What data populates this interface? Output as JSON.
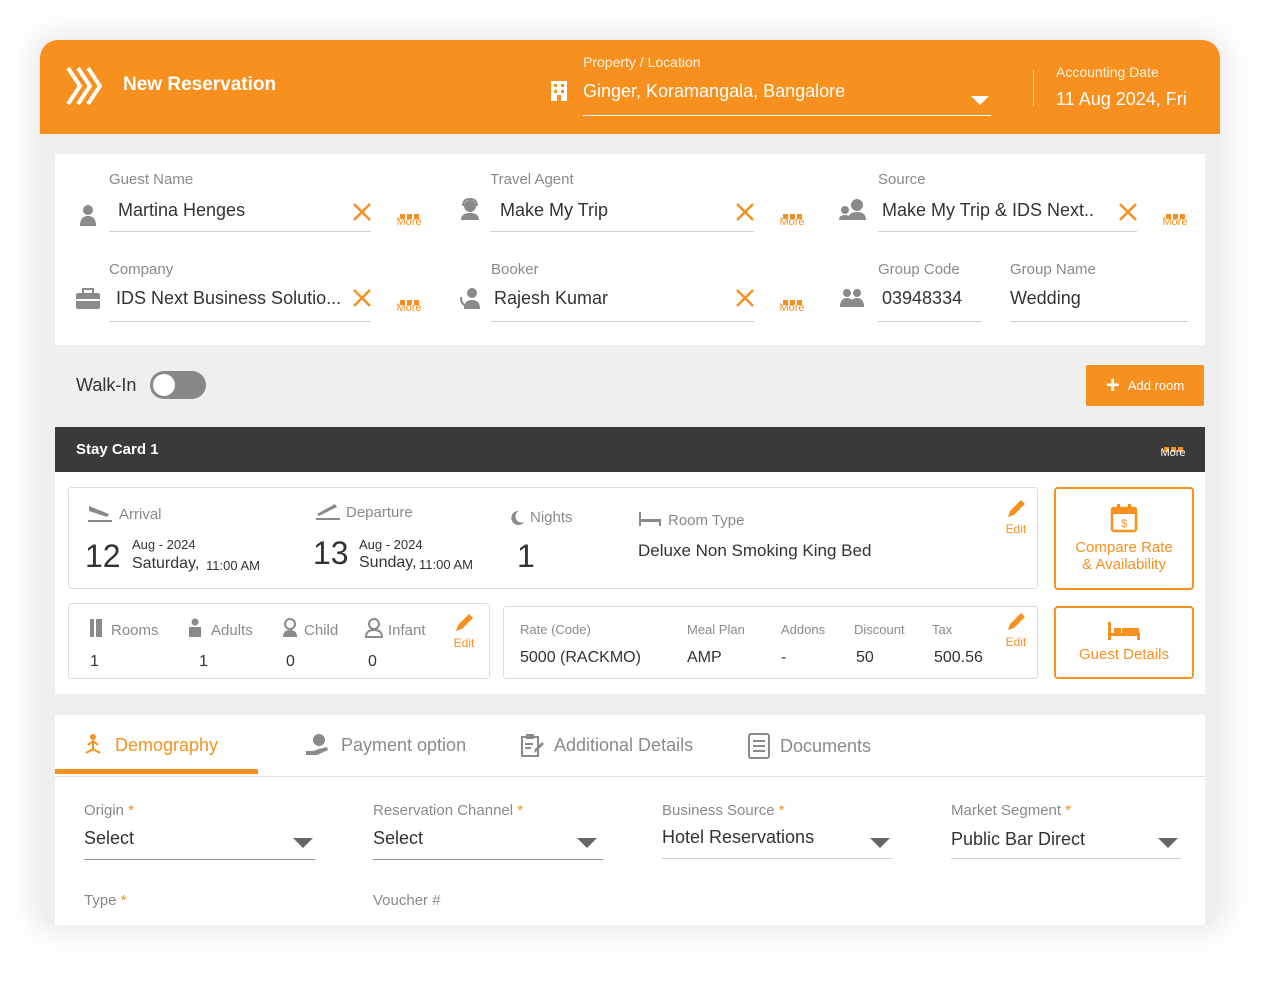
{
  "header": {
    "title": "New Reservation",
    "property_label": "Property / Location",
    "property_value": "Ginger, Koramangala, Bangalore",
    "accounting_label": "Accounting Date",
    "accounting_value": "11 Aug 2024, Fri"
  },
  "guest_info": {
    "guest_name_label": "Guest Name",
    "guest_name": "Martina Henges",
    "travel_agent_label": "Travel Agent",
    "travel_agent": "Make My Trip",
    "source_label": "Source",
    "source": "Make My Trip & IDS Next..",
    "company_label": "Company",
    "company": "IDS Next Business Solutio...",
    "booker_label": "Booker",
    "booker": "Rajesh Kumar",
    "group_code_label": "Group Code",
    "group_code": "03948334",
    "group_name_label": "Group Name",
    "group_name": "Wedding",
    "more_label": "More"
  },
  "walkin": {
    "label": "Walk-In",
    "enabled": false
  },
  "add_room_label": "Add room",
  "stay_card": {
    "title": "Stay Card 1",
    "more_label": "More",
    "arrival_label": "Arrival",
    "arrival_day": "12",
    "arrival_month": "Aug - 2024",
    "arrival_weekday": "Saturday,",
    "arrival_time": "11:00 AM",
    "departure_label": "Departure",
    "departure_day": "13",
    "departure_month": "Aug - 2024",
    "departure_weekday": "Sunday,",
    "departure_time": "11:00 AM",
    "nights_label": "Nights",
    "nights": "1",
    "room_type_label": "Room Type",
    "room_type": "Deluxe Non Smoking King Bed",
    "edit_label": "Edit",
    "compare_label_1": "Compare Rate",
    "compare_label_2": "& Availability",
    "rooms_label": "Rooms",
    "rooms": "1",
    "adults_label": "Adults",
    "adults": "1",
    "child_label": "Child",
    "child": "0",
    "infant_label": "Infant",
    "infant": "0",
    "rate_label": "Rate (Code)",
    "rate": "5000  (RACKMO)",
    "meal_label": "Meal Plan",
    "meal": "AMP",
    "addons_label": "Addons",
    "addons": "-",
    "discount_label": "Discount",
    "discount": "50",
    "tax_label": "Tax",
    "tax": "500.56",
    "guest_details_label": "Guest Details"
  },
  "tabs": [
    {
      "label": "Demography",
      "active": true
    },
    {
      "label": "Payment option",
      "active": false
    },
    {
      "label": "Additional Details",
      "active": false
    },
    {
      "label": "Documents",
      "active": false
    }
  ],
  "form": {
    "origin_label": "Origin",
    "origin": "Select",
    "channel_label": "Reservation Channel",
    "channel": "Select",
    "business_source_label": "Business Source",
    "business_source": "Hotel Reservations",
    "market_segment_label": "Market Segment",
    "market_segment": "Public Bar Direct",
    "type_label": "Type",
    "voucher_label": "Voucher #",
    "required_mark": "*"
  },
  "colors": {
    "accent": "#f7901e",
    "dark_bar": "#3a3a3a"
  }
}
